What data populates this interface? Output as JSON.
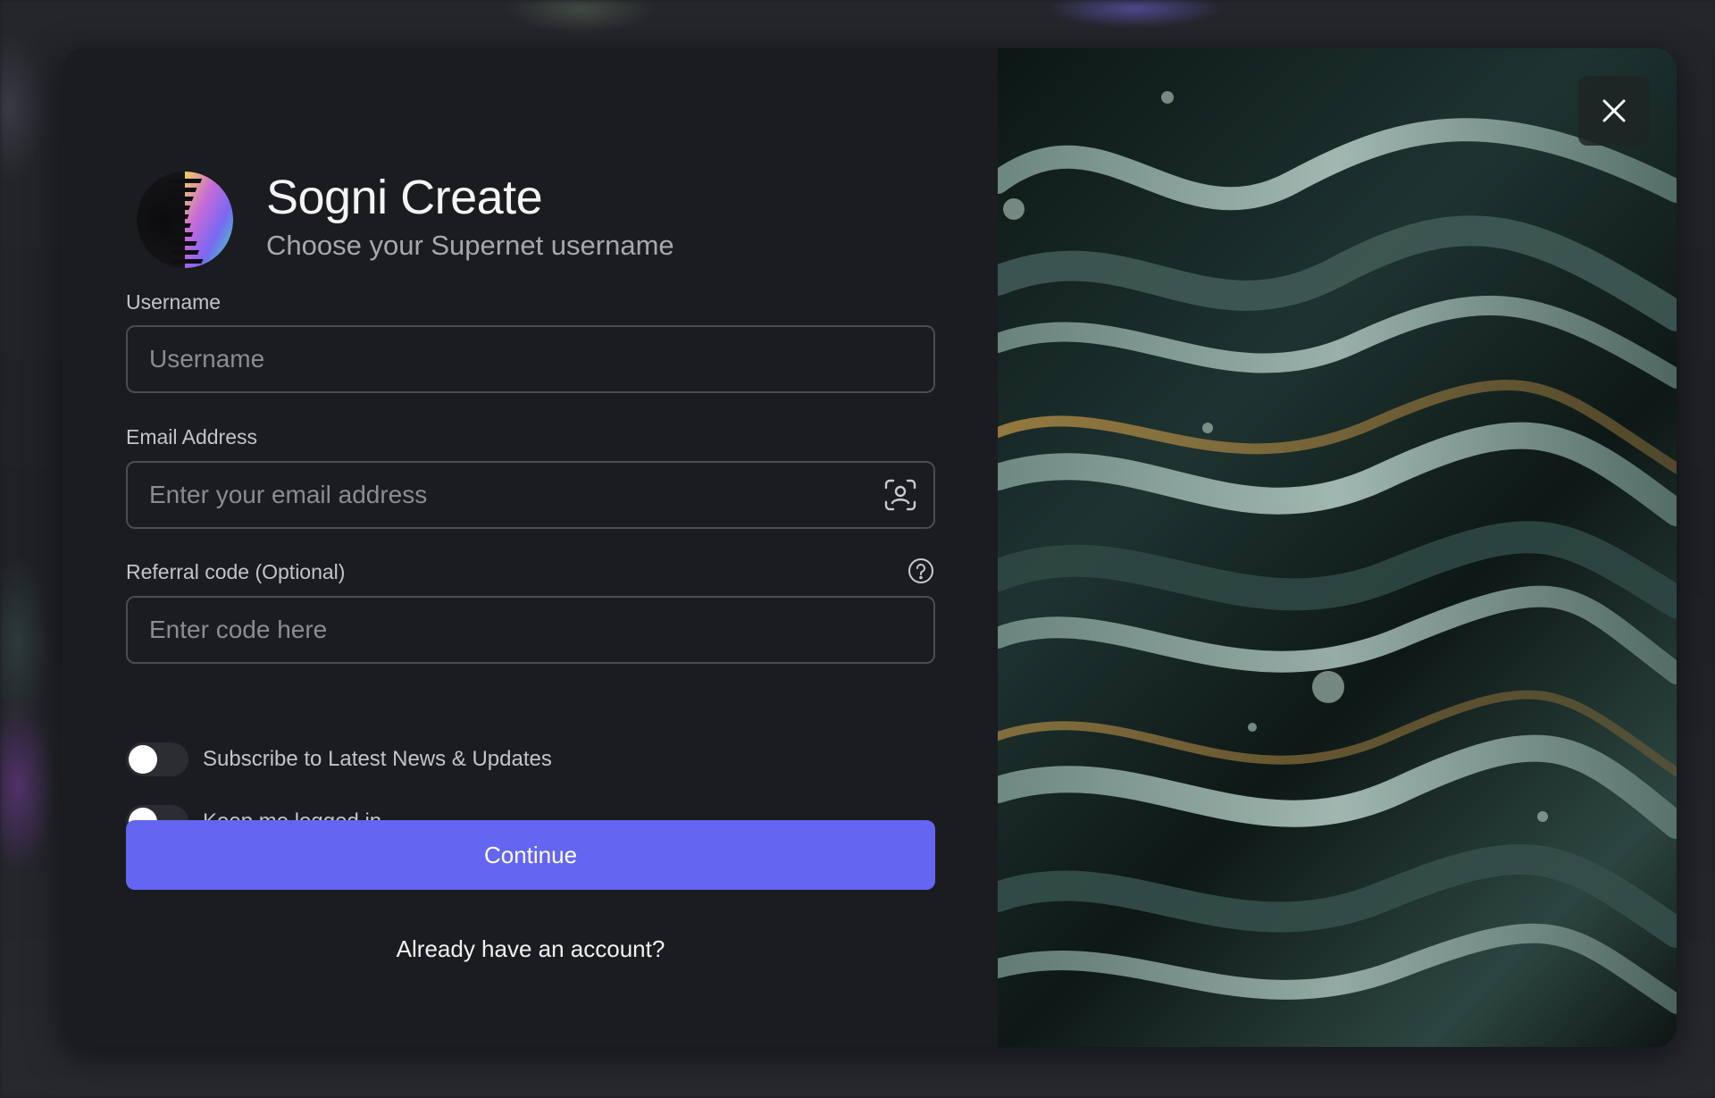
{
  "app": {
    "title": "Sogni Create",
    "subtitle": "Choose your Supernet username"
  },
  "form": {
    "username": {
      "label": "Username",
      "placeholder": "Username",
      "value": ""
    },
    "email": {
      "label": "Email Address",
      "placeholder": "Enter your email address",
      "value": "",
      "icon": "contact-autofill-icon"
    },
    "referral": {
      "label": "Referral code (Optional)",
      "placeholder": "Enter code here",
      "value": "",
      "help_icon": "question-circle-icon"
    },
    "toggles": [
      {
        "label": "Subscribe to Latest News & Updates",
        "checked": false
      },
      {
        "label": "Keep me logged in",
        "checked": false
      }
    ],
    "continue_label": "Continue",
    "login_link": "Already have an account?"
  },
  "close_icon": "close-icon",
  "colors": {
    "accent": "#6366f1",
    "panel_bg": "#1a1c20",
    "input_border": "#4a4c52"
  }
}
